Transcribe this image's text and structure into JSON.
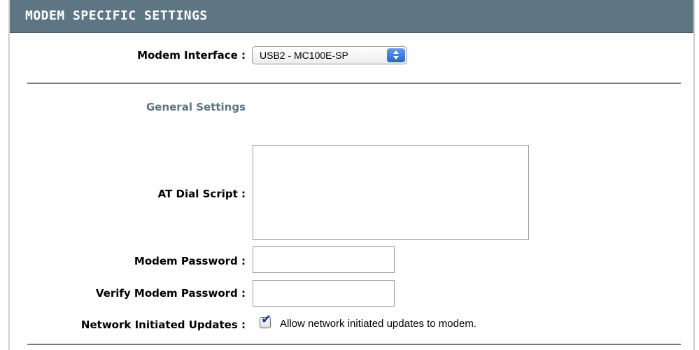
{
  "header": {
    "title": "MODEM SPECIFIC SETTINGS"
  },
  "modem_interface": {
    "label": "Modem Interface :",
    "selected_value": "USB2 - MC100E-SP"
  },
  "general_settings": {
    "section_label": "General Settings"
  },
  "at_dial_script": {
    "label": "AT Dial Script :",
    "value": ""
  },
  "modem_password": {
    "label": "Modem Password :",
    "value": ""
  },
  "verify_modem_password": {
    "label": "Verify Modem Password :",
    "value": ""
  },
  "network_initiated_updates": {
    "label": "Network Initiated Updates :",
    "checkbox_label": "Allow network initiated updates to modem.",
    "checked": true
  },
  "colors": {
    "header_background": "#5e7584",
    "section_label": "#5e7584",
    "select_arrow": "#2a63c9"
  },
  "icons": {
    "select_arrows": "up-down-arrows-icon",
    "checkbox_check": "checkmark-icon"
  }
}
